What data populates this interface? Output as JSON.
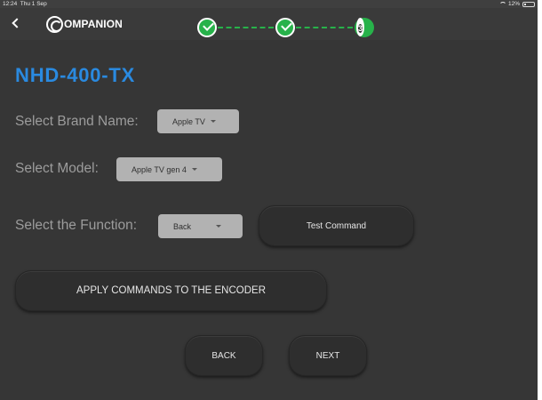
{
  "status_bar": {
    "time": "12:24",
    "date": "Thu 1 Sep",
    "battery": "12%"
  },
  "header": {
    "logo_text": "OMPANION",
    "stepper": {
      "steps": [
        {
          "state": "done"
        },
        {
          "state": "done"
        },
        {
          "state": "current",
          "label": "3"
        }
      ],
      "accent_color": "#27b24a"
    }
  },
  "main": {
    "title": "NHD-400-TX",
    "brand": {
      "label": "Select Brand Name:",
      "value": "Apple TV"
    },
    "model": {
      "label": "Select Model:",
      "value": "Apple TV gen 4"
    },
    "function": {
      "label": "Select the Function:",
      "value": "Back"
    },
    "test_command_label": "Test Command",
    "apply_label": "APPLY COMMANDS TO THE ENCODER",
    "back_label": "BACK",
    "next_label": "NEXT"
  },
  "colors": {
    "title": "#2a8ae0",
    "background": "#363636",
    "dropdown": "#b2b2b2",
    "button": "#2e2e2e"
  }
}
